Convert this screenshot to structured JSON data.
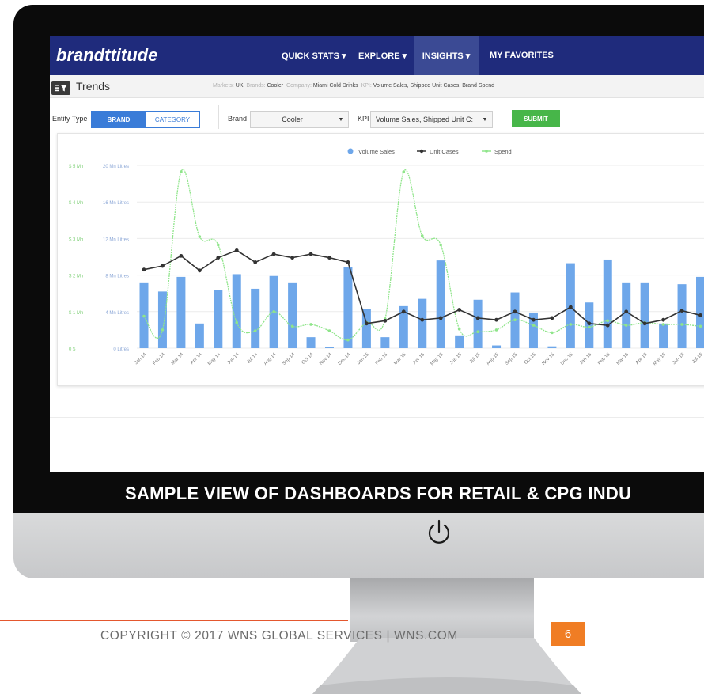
{
  "caption": "SAMPLE VIEW OF DASHBOARDS FOR RETAIL & CPG INDU",
  "footer": {
    "copyright": "COPYRIGHT © 2017 WNS GLOBAL SERVICES  |  WNS.COM",
    "page_number": "6"
  },
  "app": {
    "brand": "brandttitude",
    "nav": [
      "QUICK STATS ▾",
      "EXPLORE ▾",
      "INSIGHTS ▾",
      "MY FAVORITES"
    ],
    "active_nav": "INSIGHTS ▾"
  },
  "subheader": {
    "title": "Trends",
    "crumbs": [
      {
        "k": "Markets:",
        "v": "UK"
      },
      {
        "k": "Brands:",
        "v": "Cooler"
      },
      {
        "k": "Company:",
        "v": "Miami Cold Drinks"
      },
      {
        "k": "KPI:",
        "v": "Volume Sales, Shipped Unit Cases, Brand Spend"
      }
    ]
  },
  "controls": {
    "entity_type_label": "Entity Type",
    "entity_brand": "BRAND",
    "entity_category": "CATEGORY",
    "brand_label": "Brand",
    "brand_value": "Cooler",
    "kpi_label": "KPI",
    "kpi_value": "Volume Sales, Shipped Unit C:",
    "submit": "SUBMIT"
  },
  "colors": {
    "navbar": "#1f2b7c",
    "bar": "#6ea7ea",
    "unit_line": "#333333",
    "spend_line": "#8fe58a",
    "submit": "#47b649",
    "accent": "#3a7cd8"
  },
  "chart_data": {
    "type": "bar",
    "legend": [
      "Volume Sales",
      "Unit Cases",
      "Spend"
    ],
    "legend_position": "top-center",
    "grid": true,
    "y_left_ticks": [
      "0 $",
      "$ 1 Mn",
      "$ 2 Mn",
      "$ 3 Mn",
      "$ 4 Mn",
      "$ 5 Mn"
    ],
    "y_right_ticks": [
      "0 Litres",
      "4 Mn Litres",
      "8 Mn Litres",
      "12 Mn Litres",
      "16 Mn Litres",
      "20 Mn Litres"
    ],
    "ylim_litres_mn": [
      0,
      20
    ],
    "categories": [
      "Jan 14",
      "Feb 14",
      "Mar 14",
      "Apr 14",
      "May 14",
      "Jun 14",
      "Jul 14",
      "Aug 14",
      "Sep 14",
      "Oct 14",
      "Nov 14",
      "Dec 14",
      "Jan 15",
      "Feb 15",
      "Mar 15",
      "Apr 15",
      "May 15",
      "Jun 15",
      "Jul 15",
      "Aug 15",
      "Sep 15",
      "Oct 15",
      "Nov 15",
      "Dec 15",
      "Jan 16",
      "Feb 16",
      "Mar 16",
      "Apr 16",
      "May 16",
      "Jun 16",
      "Jul 16"
    ],
    "series": [
      {
        "name": "Volume Sales",
        "type": "bar",
        "values": [
          7.2,
          6.2,
          7.8,
          2.7,
          6.4,
          8.1,
          6.5,
          7.9,
          7.2,
          1.2,
          0.1,
          8.9,
          4.3,
          1.2,
          4.6,
          5.4,
          9.6,
          1.4,
          5.3,
          0.3,
          6.1,
          3.9,
          0.2,
          9.3,
          5.0,
          9.7,
          7.2,
          7.2,
          2.7,
          7.0,
          7.8
        ]
      },
      {
        "name": "Unit Cases",
        "type": "line",
        "values": [
          8.6,
          9.0,
          10.1,
          8.5,
          9.9,
          10.7,
          9.4,
          10.3,
          9.9,
          10.3,
          9.9,
          9.4,
          2.7,
          3.0,
          4.0,
          3.1,
          3.3,
          4.2,
          3.3,
          3.1,
          4.0,
          3.1,
          3.3,
          4.5,
          2.7,
          2.5,
          4.0,
          2.7,
          3.1,
          4.1,
          3.6
        ]
      },
      {
        "name": "Spend",
        "type": "line",
        "values": [
          3.5,
          2.0,
          19.3,
          12.2,
          11.3,
          2.8,
          1.9,
          4.0,
          2.4,
          2.6,
          1.9,
          0.9,
          2.8,
          3.2,
          19.3,
          12.3,
          11.3,
          2.1,
          1.8,
          2.0,
          3.1,
          2.5,
          1.7,
          2.6,
          2.3,
          3.0,
          2.5,
          2.8,
          2.6,
          2.6,
          2.4
        ]
      }
    ]
  }
}
